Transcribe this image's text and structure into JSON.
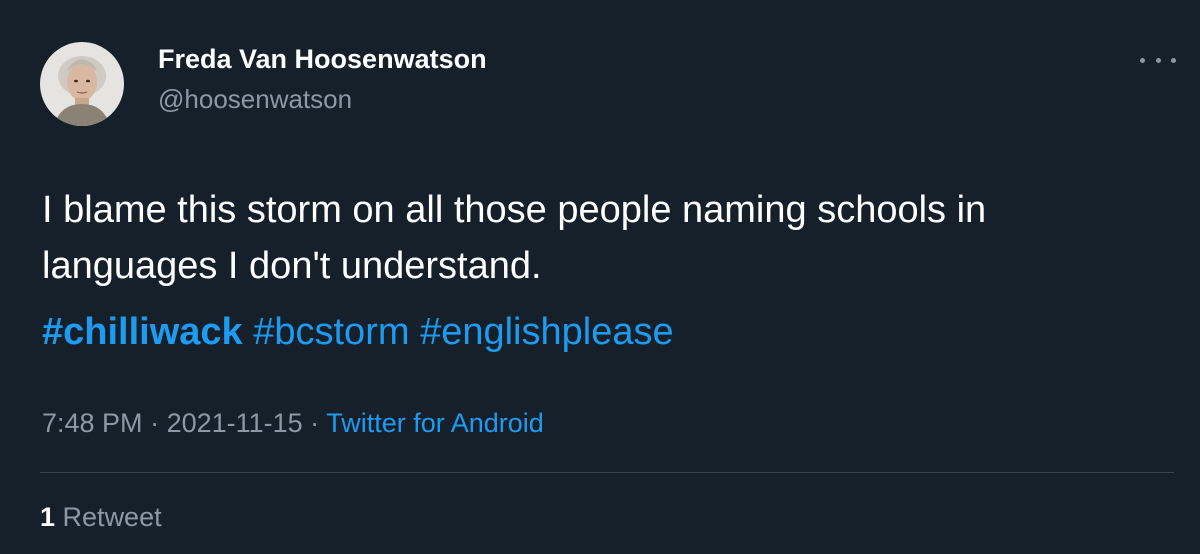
{
  "user": {
    "display_name": "Freda Van Hoosenwatson",
    "handle": "@hoosenwatson"
  },
  "tweet": {
    "text": "I blame this storm on all those people naming schools in languages I don't understand.",
    "hashtags": [
      "#chilliwack",
      "#bcstorm",
      "#englishplease"
    ]
  },
  "meta": {
    "time": "7:48 PM",
    "separator": " · ",
    "date": "2021-11-15",
    "source": "Twitter for Android"
  },
  "stats": {
    "retweet_count": "1",
    "retweet_label": "Retweet"
  },
  "icons": {
    "more": "more-horizontal-icon"
  },
  "colors": {
    "background": "#15202b",
    "link": "#1d9bf0",
    "secondary_text": "#8b98a5"
  }
}
